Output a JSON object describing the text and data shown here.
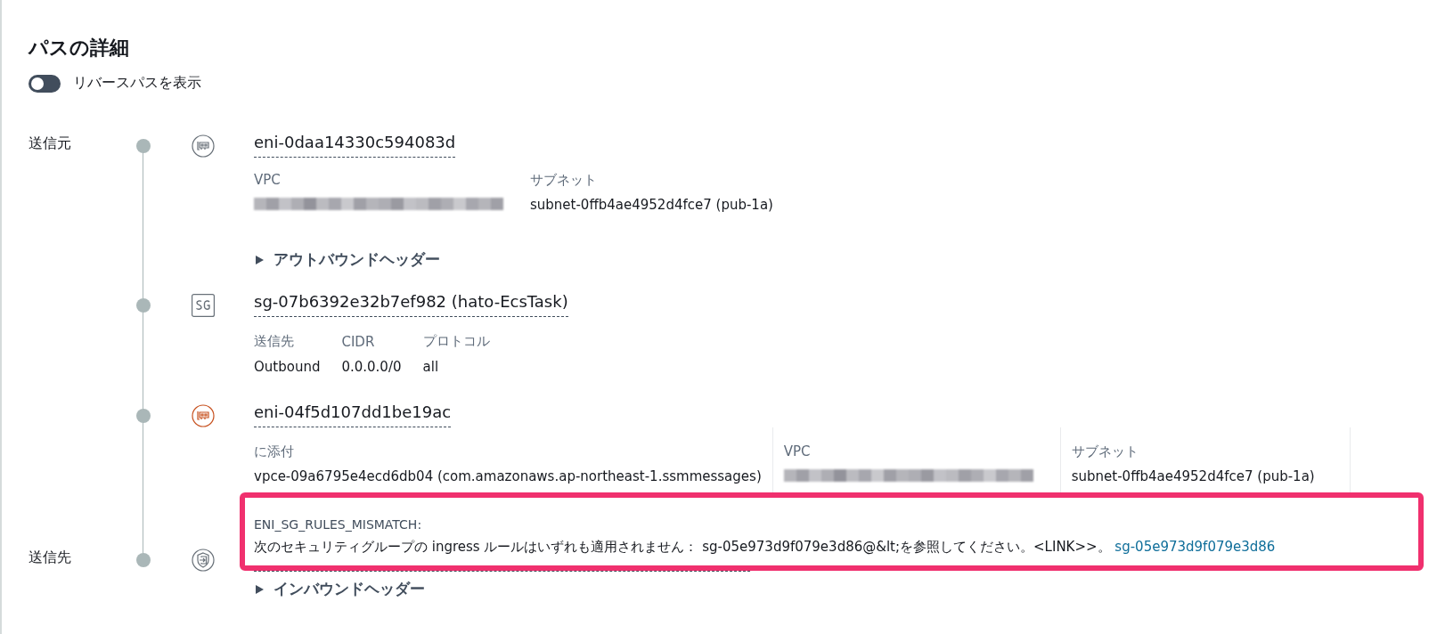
{
  "title": "パスの詳細",
  "reverse_toggle": {
    "label": "リバースパスを表示",
    "on": false
  },
  "steps": [
    {
      "label": "送信元",
      "kind": "eni",
      "error": false,
      "id": "eni-0daa14330c594083d",
      "bordered": false,
      "fields": [
        {
          "name": "VPC",
          "redacted": true
        },
        {
          "name": "サブネット",
          "value": "subnet-0ffb4ae4952d4fce7 (pub-1a)"
        }
      ],
      "expander": {
        "label": "アウトバウンドヘッダー",
        "expanded": false
      }
    },
    {
      "kind": "sg",
      "id": "sg-07b6392e32b7ef982 (hato-EcsTask)",
      "table": {
        "columns": [
          "送信先",
          "CIDR",
          "プロトコル"
        ],
        "rows": [
          [
            "Outbound",
            "0.0.0.0/0",
            "all"
          ]
        ]
      }
    },
    {
      "kind": "eni",
      "error": true,
      "id": "eni-04f5d107dd1be19ac",
      "bordered": true,
      "fields": [
        {
          "name": "に添付",
          "value": "vpce-09a6795e4ecd6db04 (com.amazonaws.ap-northeast-1.ssmmessages)"
        },
        {
          "name": "VPC",
          "redacted": true
        },
        {
          "name": "サブネット",
          "value": "subnet-0ffb4ae4952d4fce7 (pub-1a)"
        }
      ]
    },
    {
      "label": "送信先",
      "kind": "endpoint",
      "expander": {
        "label": "インバウンドヘッダー",
        "expanded": false
      }
    }
  ],
  "popup": {
    "code": "ENI_SG_RULES_MISMATCH:",
    "message": "次のセキュリティグループの ingress ルールはいずれも適用されません： sg-05e973d9f079e3d86@&lt;を参照してください。<LINK>>。",
    "link": "sg-05e973d9f079e3d86"
  }
}
